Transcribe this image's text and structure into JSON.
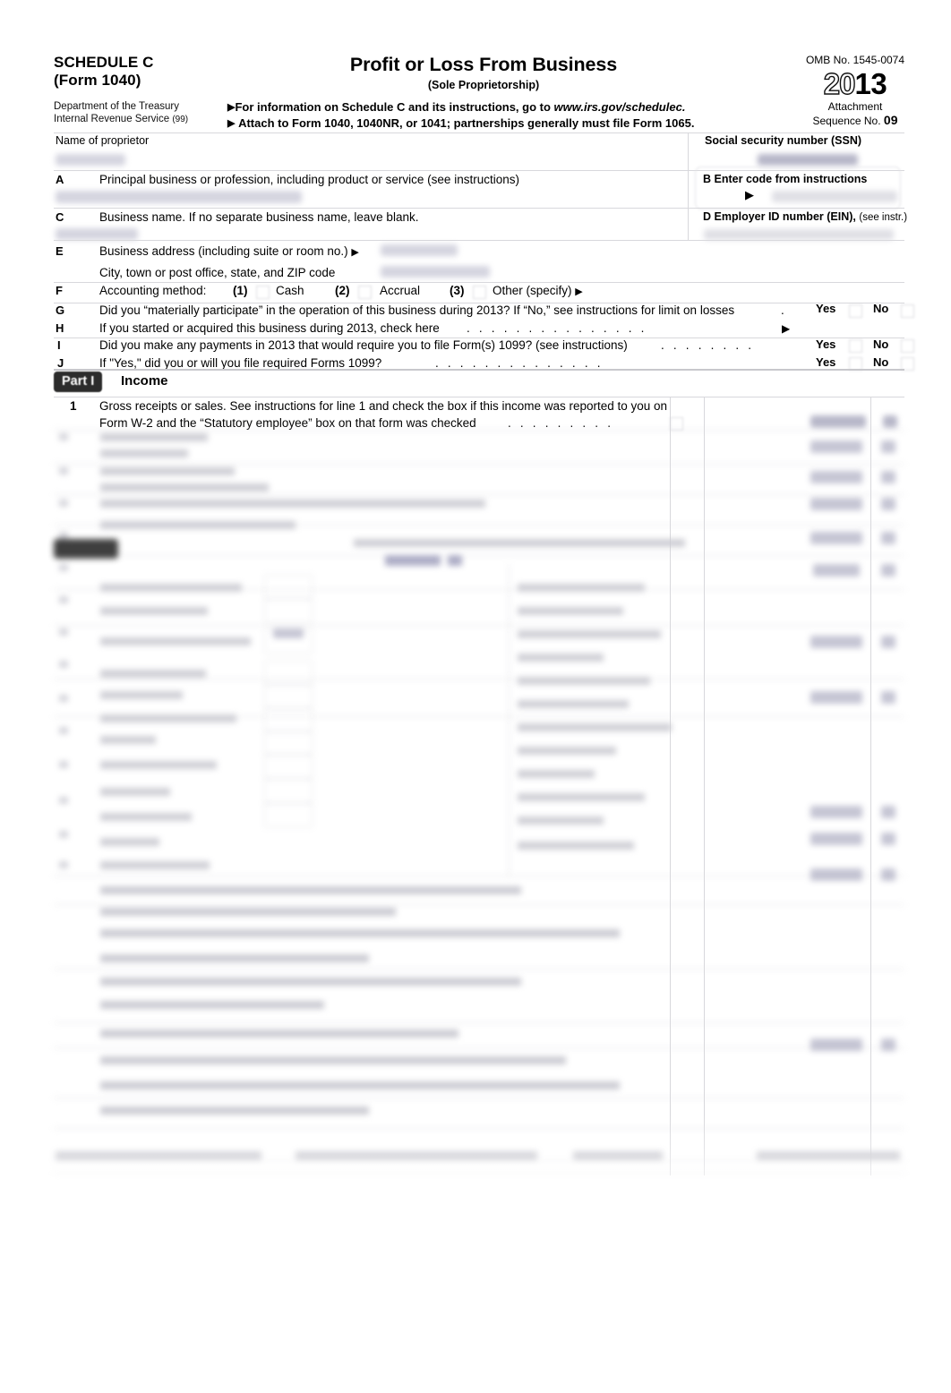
{
  "form": {
    "schedule_line1": "SCHEDULE C",
    "schedule_line2": "(Form 1040)",
    "department_line1": "Department of the Treasury",
    "department_line2": "Internal Revenue Service",
    "department_suffix": "(99)",
    "title": "Profit or Loss From Business",
    "subtitle": "(Sole Proprietorship)",
    "instruction_line_1_prefix": "For information on Schedule C and its instructions, go to ",
    "instruction_line_1_url": "www.irs.gov/schedulec.",
    "instruction_line_2": "Attach to Form 1040, 1040NR, or 1041; partnerships generally must file Form 1065.",
    "omb": "OMB No. 1545-0074",
    "year_outline": "20",
    "year_solid": "13",
    "attachment_label": "Attachment",
    "sequence_label": "Sequence No.",
    "sequence_number": "09"
  },
  "identity": {
    "proprietor_label": "Name of proprietor",
    "proprietor_value": "",
    "ssn_label": "Social security number (SSN)",
    "ssn_value": ""
  },
  "lines": {
    "a": {
      "letter": "A",
      "text": "Principal business or profession, including product or service (see instructions)",
      "value": ""
    },
    "b": {
      "letter": "B",
      "text": "Enter code from instructions",
      "arrow": "▶",
      "value": ""
    },
    "c": {
      "letter": "C",
      "text": "Business name. If no separate business name, leave blank.",
      "value": ""
    },
    "d": {
      "letter": "D",
      "text": "Employer ID number (EIN),",
      "text_small": "(see instr.)",
      "value": ""
    },
    "e": {
      "letter": "E",
      "text": "Business address (including suite or room no.)",
      "arrow": "▶",
      "value": "",
      "text2": "City, town or post office, state, and ZIP code",
      "value2": ""
    },
    "f": {
      "letter": "F",
      "text": "Accounting method:",
      "opt1_num": "(1)",
      "opt1_label": "Cash",
      "opt2_num": "(2)",
      "opt2_label": "Accrual",
      "opt3_num": "(3)",
      "opt3_label": "Other (specify)",
      "arrow": "▶"
    },
    "g": {
      "letter": "G",
      "text": "Did you “materially participate” in the operation of this business during 2013? If “No,” see instructions for limit on losses",
      "trailing_dots": ".",
      "yes": "Yes",
      "no": "No"
    },
    "h": {
      "letter": "H",
      "text": "If you started or acquired this business during 2013, check here",
      "dots": ". . . . . . . . . . . . . . .",
      "arrow": "▶"
    },
    "i": {
      "letter": "I",
      "text": "Did you make any payments in 2013 that would require you to file Form(s) 1099? (see instructions)",
      "dots": ". . . . . . . .",
      "yes": "Yes",
      "no": "No"
    },
    "j": {
      "letter": "J",
      "text": "If \"Yes,\" did you or will you file required Forms 1099?",
      "dots": ". . . . . . . . . . . . . .",
      "yes": "Yes",
      "no": "No"
    }
  },
  "part1": {
    "badge": "Part I",
    "title": "Income",
    "line1": {
      "number": "1",
      "text_l1": "Gross receipts or sales. See instructions for line 1 and check the box if this income was reported to you on",
      "text_l2": "Form W-2 and the “Statutory employee” box on that form was checked",
      "dots": ". . . . . . . . .",
      "amount": "",
      "cents": ""
    }
  },
  "redacted_region": {
    "note": "",
    "part2_badge": "",
    "part2_title": ""
  },
  "colors": {
    "page_background": "#ffffff",
    "text": "#000000",
    "part_badge_background": "#2c2c2c",
    "rule": "#d8d8dc",
    "filled_value_blur": "#9a9ab4"
  }
}
